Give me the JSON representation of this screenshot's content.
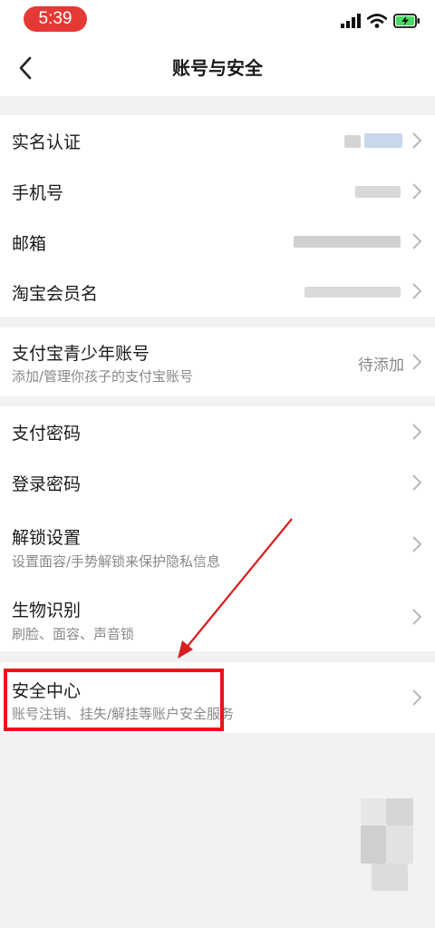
{
  "status_bar": {
    "time": "5:39"
  },
  "nav": {
    "title": "账号与安全"
  },
  "groups": [
    {
      "items": [
        {
          "title": "实名认证"
        },
        {
          "title": "手机号"
        },
        {
          "title": "邮箱"
        },
        {
          "title": "淘宝会员名"
        }
      ]
    },
    {
      "items": [
        {
          "title": "支付宝青少年账号",
          "subtitle": "添加/管理你孩子的支付宝账号",
          "value": "待添加"
        }
      ]
    },
    {
      "items": [
        {
          "title": "支付密码"
        },
        {
          "title": "登录密码"
        },
        {
          "title": "解锁设置",
          "subtitle": "设置面容/手势解锁来保护隐私信息"
        },
        {
          "title": "生物识别",
          "subtitle": "刷脸、面容、声音锁"
        }
      ]
    },
    {
      "items": [
        {
          "title": "安全中心",
          "subtitle": "账号注销、挂失/解挂等账户安全服务"
        }
      ]
    }
  ],
  "colors": {
    "accent_red": "#e8141a",
    "time_pill": "#e53935",
    "battery_green": "#4cd964"
  },
  "icons": [
    "back-arrow-icon",
    "signal-icon",
    "wifi-icon",
    "battery-charging-icon",
    "chevron-right-icon"
  ]
}
